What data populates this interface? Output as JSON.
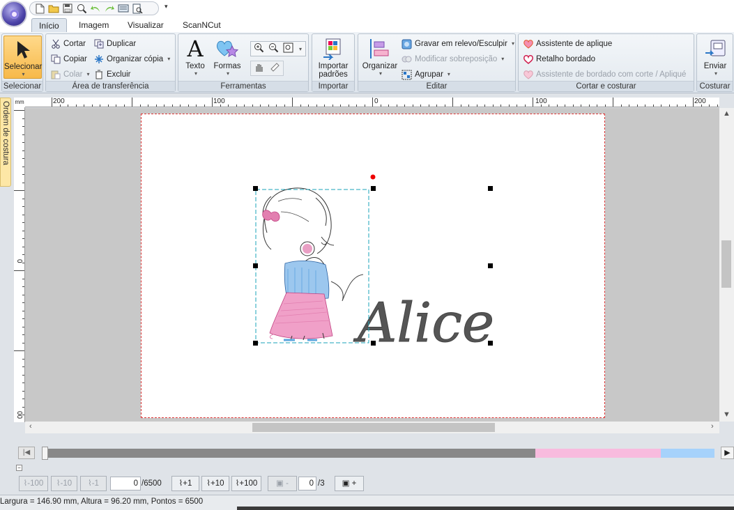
{
  "app": {
    "quick_access_icons": [
      "new-file-icon",
      "open-folder-icon",
      "save-icon",
      "zoom-icon",
      "undo-icon",
      "redo-icon",
      "card-icon",
      "preview-icon"
    ],
    "quick_access_dropdown": "▾"
  },
  "tabs": [
    {
      "label": "Início",
      "active": true
    },
    {
      "label": "Imagem",
      "active": false
    },
    {
      "label": "Visualizar",
      "active": false
    },
    {
      "label": "ScanNCut",
      "active": false
    }
  ],
  "ribbon": {
    "select_group": {
      "button": "Selecionar",
      "label": "Selecionar"
    },
    "clipboard": {
      "label": "Área de transferência",
      "cut": "Cortar",
      "copy": "Copiar",
      "paste": "Colar",
      "duplicate": "Duplicar",
      "arrange_copy": "Organizar cópia",
      "delete": "Excluir"
    },
    "tools": {
      "label": "Ferramentas",
      "text": "Texto",
      "shapes": "Formas"
    },
    "import": {
      "label": "Importar",
      "button_line1": "Importar",
      "button_line2": "padrões"
    },
    "edit": {
      "label": "Editar",
      "arrange": "Organizar",
      "emboss": "Gravar em relevo/Esculpir",
      "modify_overlap": "Modificar sobreposição",
      "group": "Agrupar"
    },
    "cut_sew": {
      "label": "Cortar e costurar",
      "applique_wizard": "Assistente de aplique",
      "patch": "Retalho bordado",
      "cut_applique_wizard": "Assistente de bordado com corte / Apliqué"
    },
    "sewing": {
      "label": "Costurar",
      "send": "Enviar"
    }
  },
  "side_tab": "Ordem de costura",
  "rulers": {
    "unit": "mm",
    "h_labels": [
      "200",
      "100",
      "0",
      "100",
      "200"
    ],
    "v_labels": [
      "0",
      "00"
    ]
  },
  "canvas": {
    "text_design": "Alice",
    "thread_colors": {
      "dark_grey": "#555555",
      "pink": "#e27fb0",
      "blue": "#5aa4de"
    }
  },
  "sequence": {
    "colors": [
      "#888888",
      "#f8bbde",
      "#a6d2fb"
    ],
    "fractions": [
      0.733,
      0.187,
      0.08
    ]
  },
  "stitch_bar": {
    "minus100": "-100",
    "minus10": "-10",
    "minus1": "-1",
    "current": "0",
    "total": "/6500",
    "plus1": "+1",
    "plus10": "+10",
    "plus100": "+100",
    "color_minus": "-",
    "color_current": "0",
    "color_total": "/3",
    "color_plus": "+"
  },
  "status": "Largura = 146.90 mm, Altura = 96.20 mm, Pontos = 6500"
}
